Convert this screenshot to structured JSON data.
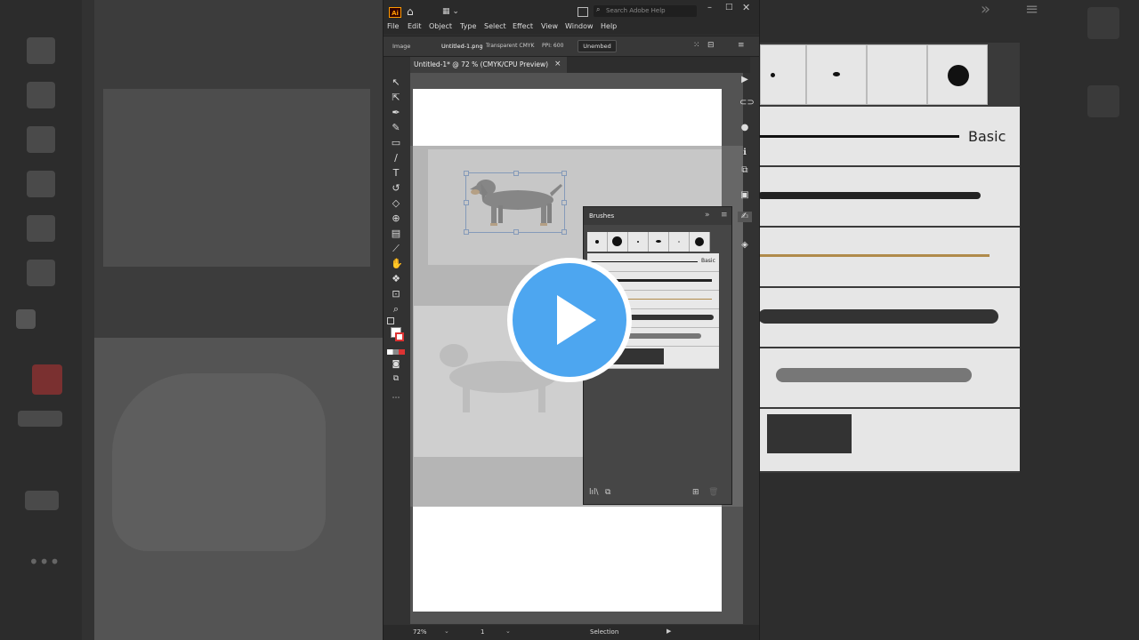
{
  "app": {
    "logo": "Ai",
    "search_placeholder": "Search Adobe Help",
    "menu": [
      "File",
      "Edit",
      "Object",
      "Type",
      "Select",
      "Effect",
      "View",
      "Window",
      "Help"
    ]
  },
  "control_bar": {
    "object_type": "Image",
    "file_name": "Untitled-1.png",
    "color_info": "Transparent CMYK",
    "ppi": "PPI: 600",
    "unembed_label": "Unembed"
  },
  "document_tab": {
    "title": "Untitled-1* @ 72 % (CMYK/CPU Preview)",
    "close": "×"
  },
  "brushes_panel": {
    "title": "Brushes",
    "basic_label": "Basic"
  },
  "background_panel": {
    "basic_label": "Basic"
  },
  "status_bar": {
    "zoom": "72%",
    "page": "1",
    "tool": "Selection"
  },
  "icons": {
    "home": "⌂",
    "selection": "▲",
    "direct": "△",
    "pen": "✒",
    "type": "T",
    "zoom": "🔍",
    "play": "▶"
  },
  "colors": {
    "play_blue": "#4da6f0",
    "app_dark": "#323232",
    "accent": "#1473e6"
  }
}
